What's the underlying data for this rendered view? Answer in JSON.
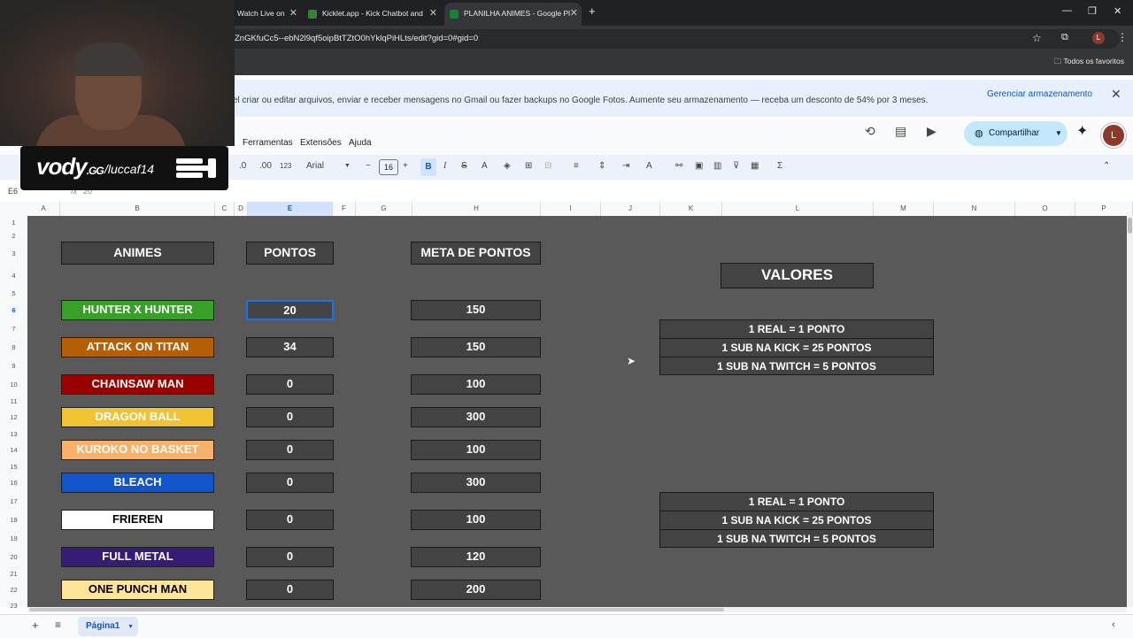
{
  "browser": {
    "tabs": [
      {
        "label": "Watch Live on"
      },
      {
        "label": "Kicklet.app - Kick Chatbot and"
      },
      {
        "label": "PLANILHA ANIMES - Google Pl"
      }
    ],
    "url": "ZnGKfuCc5--ebN2l9qf5oipBtTZtO0hYklqPiHLts/edit?gid=0#gid=0",
    "bookmarks_label": "Todos os favoritos"
  },
  "banner": {
    "text": "el criar ou editar arquivos, enviar e receber mensagens no Gmail ou fazer backups no Google Fotos. Aumente seu armazenamento — receba um desconto de 54% por 3 meses.",
    "link": "Gerenciar armazenamento"
  },
  "menu": {
    "items": [
      "Ferramentas",
      "Extensões",
      "Ajuda"
    ],
    "share_label": "Compartilhar",
    "avatar_letter": "L"
  },
  "toolbar": {
    "font": "Arial",
    "font_size": "16",
    "zoom_fmt": "123"
  },
  "formula": {
    "cell_ref": "E6",
    "value": "20"
  },
  "columns": [
    "A",
    "B",
    "C",
    "D",
    "E",
    "F",
    "G",
    "H",
    "I",
    "J",
    "K",
    "L",
    "M",
    "N",
    "O",
    "P"
  ],
  "rows": [
    "1",
    "2",
    "3",
    "4",
    "5",
    "6",
    "7",
    "8",
    "9",
    "10",
    "11",
    "12",
    "13",
    "14",
    "15",
    "16",
    "17",
    "18",
    "19",
    "20",
    "21",
    "22",
    "23"
  ],
  "sheet": {
    "headers": {
      "animes": "ANIMES",
      "pontos": "PONTOS",
      "meta": "META DE PONTOS",
      "valores": "VALORES"
    },
    "animes": [
      {
        "name": "HUNTER X HUNTER",
        "pontos": "20",
        "meta": "150",
        "color": "#38a028",
        "text_color": "#ffffff"
      },
      {
        "name": "ATTACK ON TITAN",
        "pontos": "34",
        "meta": "150",
        "color": "#b45f06",
        "text_color": "#ffffff"
      },
      {
        "name": "CHAINSAW MAN",
        "pontos": "0",
        "meta": "100",
        "color": "#990000",
        "text_color": "#ffffff"
      },
      {
        "name": "DRAGON BALL",
        "pontos": "0",
        "meta": "300",
        "color": "#f1c232",
        "text_color": "#ffffff"
      },
      {
        "name": "KUROKO NO BASKET",
        "pontos": "0",
        "meta": "100",
        "color": "#f6b26b",
        "text_color": "#ffffff"
      },
      {
        "name": "BLEACH",
        "pontos": "0",
        "meta": "300",
        "color": "#1155cc",
        "text_color": "#ffffff"
      },
      {
        "name": "FRIEREN",
        "pontos": "0",
        "meta": "100",
        "color": "#ffffff",
        "text_color": "#000000"
      },
      {
        "name": "FULL METAL",
        "pontos": "0",
        "meta": "120",
        "color": "#351c75",
        "text_color": "#ffffff"
      },
      {
        "name": "ONE PUNCH MAN",
        "pontos": "0",
        "meta": "200",
        "color": "#ffe599",
        "text_color": "#000000"
      }
    ],
    "valores_1": [
      "1 REAL = 1 PONTO",
      "1 SUB NA KICK = 25 PONTOS",
      "1 SUB NA TWITCH = 5 PONTOS"
    ],
    "valores_2": [
      "1 REAL = 1 PONTO",
      "1 SUB NA KICK = 25 PONTOS",
      "1 SUB NA TWITCH = 5 PONTOS"
    ]
  },
  "sheet_tab": "Página1",
  "overlay": {
    "brand": "vody",
    "brand_suffix": ".GG",
    "handle": "/luccaf14"
  }
}
